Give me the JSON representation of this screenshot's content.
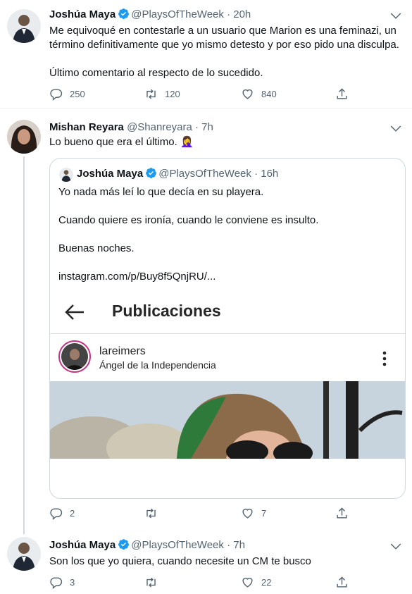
{
  "tweets": [
    {
      "name": "Joshúa Maya",
      "handle": "@PlaysOfTheWeek",
      "time": "· 20h",
      "text": [
        "Me equivoqué en contestarle a un usuario que Marion es una feminazi, un",
        "término definitivamente que yo mismo detesto y por eso pido una disculpa.",
        "",
        "Último comentario al respecto de lo sucedido."
      ],
      "replies": "250",
      "retweets": "120",
      "likes": "840"
    },
    {
      "name": "Mishan Reyara",
      "handle": "@Shanreyara",
      "time": "· 7h",
      "text": [
        "Lo bueno que era el último. 🤦‍♀️"
      ],
      "replies": "2",
      "retweets": "",
      "likes": "7",
      "quote": {
        "name": "Joshúa Maya",
        "handle": "@PlaysOfTheWeek",
        "time": "· 16h",
        "lines": [
          "Yo nada más leí lo que decía en su playera.",
          "Cuando quiere es ironía, cuando le conviene es insulto.",
          "Buenas noches.",
          "instagram.com/p/Buy8f5QnjRU/..."
        ],
        "preview": {
          "title": "Publicaciones",
          "username": "lareimers",
          "location": "Ángel de la Independencia"
        }
      }
    },
    {
      "name": "Joshúa Maya",
      "handle": "@PlaysOfTheWeek",
      "time": "· 7h",
      "text": [
        "Son los que yo quiera, cuando necesite un CM te busco"
      ],
      "replies": "3",
      "retweets": "",
      "likes": "22"
    }
  ],
  "colors": {
    "verified": "#1d9bf0",
    "secondary_text": "#536471",
    "border": "#cfd9de",
    "divider": "#eff3f4"
  }
}
